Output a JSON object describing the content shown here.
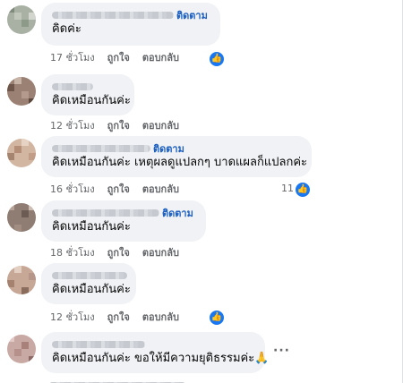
{
  "comments": [
    {
      "follow": "ติดตาม",
      "text": "คิดค่ะ",
      "time": "17 ชั่วโมง",
      "like": "ถูกใจ",
      "reply": "ตอบกลับ",
      "reaction": "like-icon",
      "reaction_count": ""
    },
    {
      "follow": "",
      "text": "คิดเหมือนกันค่ะ",
      "time": "12 ชั่วโมง",
      "like": "ถูกใจ",
      "reply": "ตอบกลับ",
      "reaction": "",
      "reaction_count": ""
    },
    {
      "follow": "ติดตาม",
      "text": "คิดเหมือนกันค่ะ เหตุผลดูแปลกๆ บาดแผลก็แปลกค่ะ",
      "time": "16 ชั่วโมง",
      "like": "ถูกใจ",
      "reply": "ตอบกลับ",
      "reaction": "like-icon",
      "reaction_count": "11"
    },
    {
      "follow": "ติดตาม",
      "text": "คิดเหมือนกันค่ะ",
      "time": "18 ชั่วโมง",
      "like": "ถูกใจ",
      "reply": "ตอบกลับ",
      "reaction": "",
      "reaction_count": ""
    },
    {
      "follow": "",
      "text": "คิดเหมือนกันค่ะ",
      "time": "12 ชั่วโมง",
      "like": "ถูกใจ",
      "reply": "ตอบกลับ",
      "reaction": "like-icon",
      "reaction_count": ""
    },
    {
      "follow": "",
      "text": "คิดเหมือนกันค่ะ ขอให้มีความยุติธรรมค่ะ🙏",
      "time": "",
      "like": "",
      "reply": "",
      "reaction": "",
      "reaction_count": "",
      "more": "···"
    }
  ],
  "colors": {
    "bubble": "#f0f2f5",
    "follow": "#1b5fc1",
    "meta": "#65676b",
    "like_badge": "#1877f2"
  }
}
